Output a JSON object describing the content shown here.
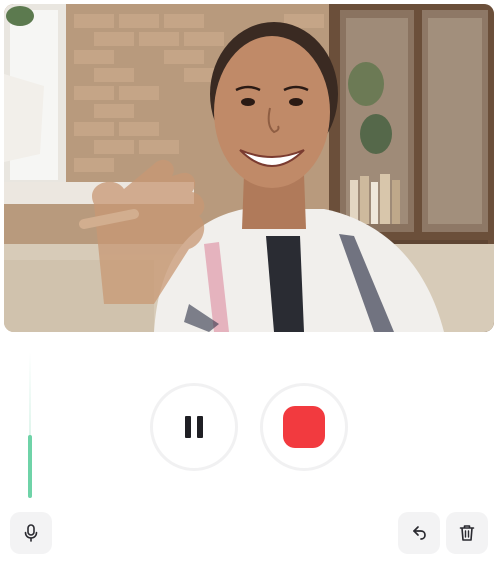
{
  "video": {
    "description_icon": "webcam-video-frame"
  },
  "level_meter": {
    "level": 0.43,
    "color": "#6fd3a8"
  },
  "controls": {
    "pause_icon": "pause-icon",
    "record_icon": "record-stop-icon",
    "record_color": "#f23a3f",
    "mic_icon": "microphone-icon",
    "undo_icon": "undo-icon",
    "trash_icon": "trash-icon"
  }
}
